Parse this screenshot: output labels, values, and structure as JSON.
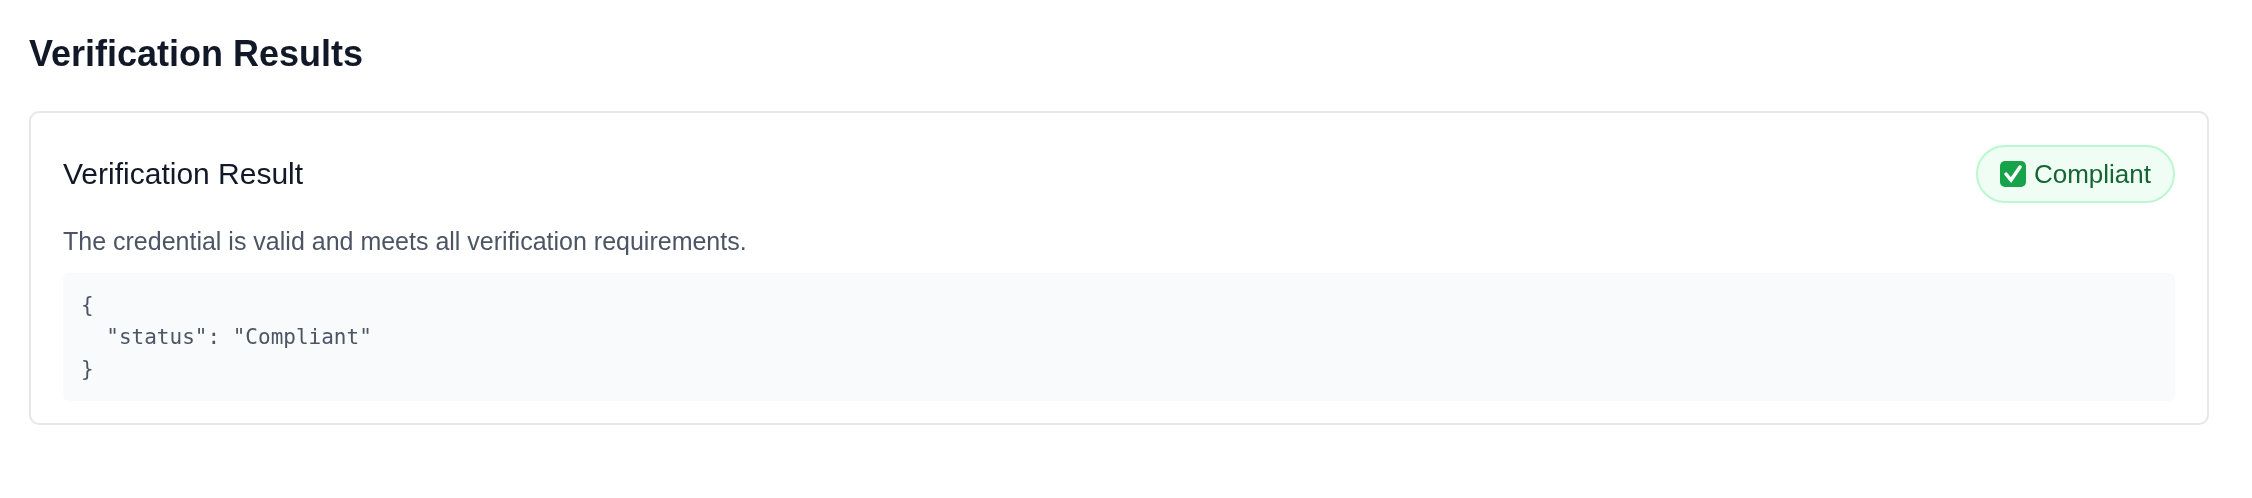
{
  "page_title": "Verification Results",
  "result": {
    "title": "Verification Result",
    "badge": {
      "label": "Compliant",
      "passed": true
    },
    "description": "The credential is valid and meets all verification requirements.",
    "code_lines": [
      "{",
      "  \"status\": \"Compliant\"",
      "}"
    ]
  }
}
